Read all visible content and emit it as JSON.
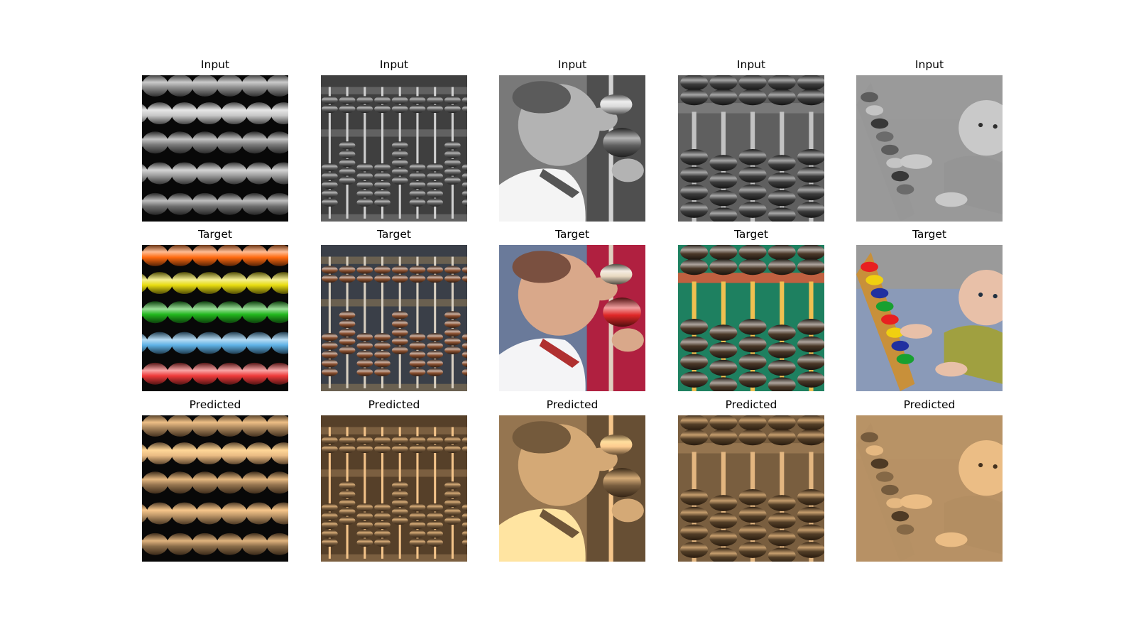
{
  "figure": {
    "rows": [
      {
        "label": "Input",
        "mode": "gray"
      },
      {
        "label": "Target",
        "mode": "color"
      },
      {
        "label": "Predicted",
        "mode": "sepia"
      }
    ],
    "columns": [
      {
        "scene": "bead-rows-closeup",
        "color_beads": [
          "#ff6a10",
          "#e8dc10",
          "#22b81e",
          "#5fb2e6",
          "#ef3a3a"
        ]
      },
      {
        "scene": "chinese-abacus",
        "color_beads": [
          "#8a5030"
        ]
      },
      {
        "scene": "baby-reaching-abacus",
        "color_beads": [
          "#e8d8c0",
          "#e02828"
        ]
      },
      {
        "scene": "abacus-rods-closeup",
        "color_beads": [
          "#4a3828"
        ]
      },
      {
        "scene": "baby-with-toy-abacus",
        "color_beads": [
          "#e82020",
          "#f0d010",
          "#2030a0",
          "#18a030"
        ]
      }
    ]
  }
}
